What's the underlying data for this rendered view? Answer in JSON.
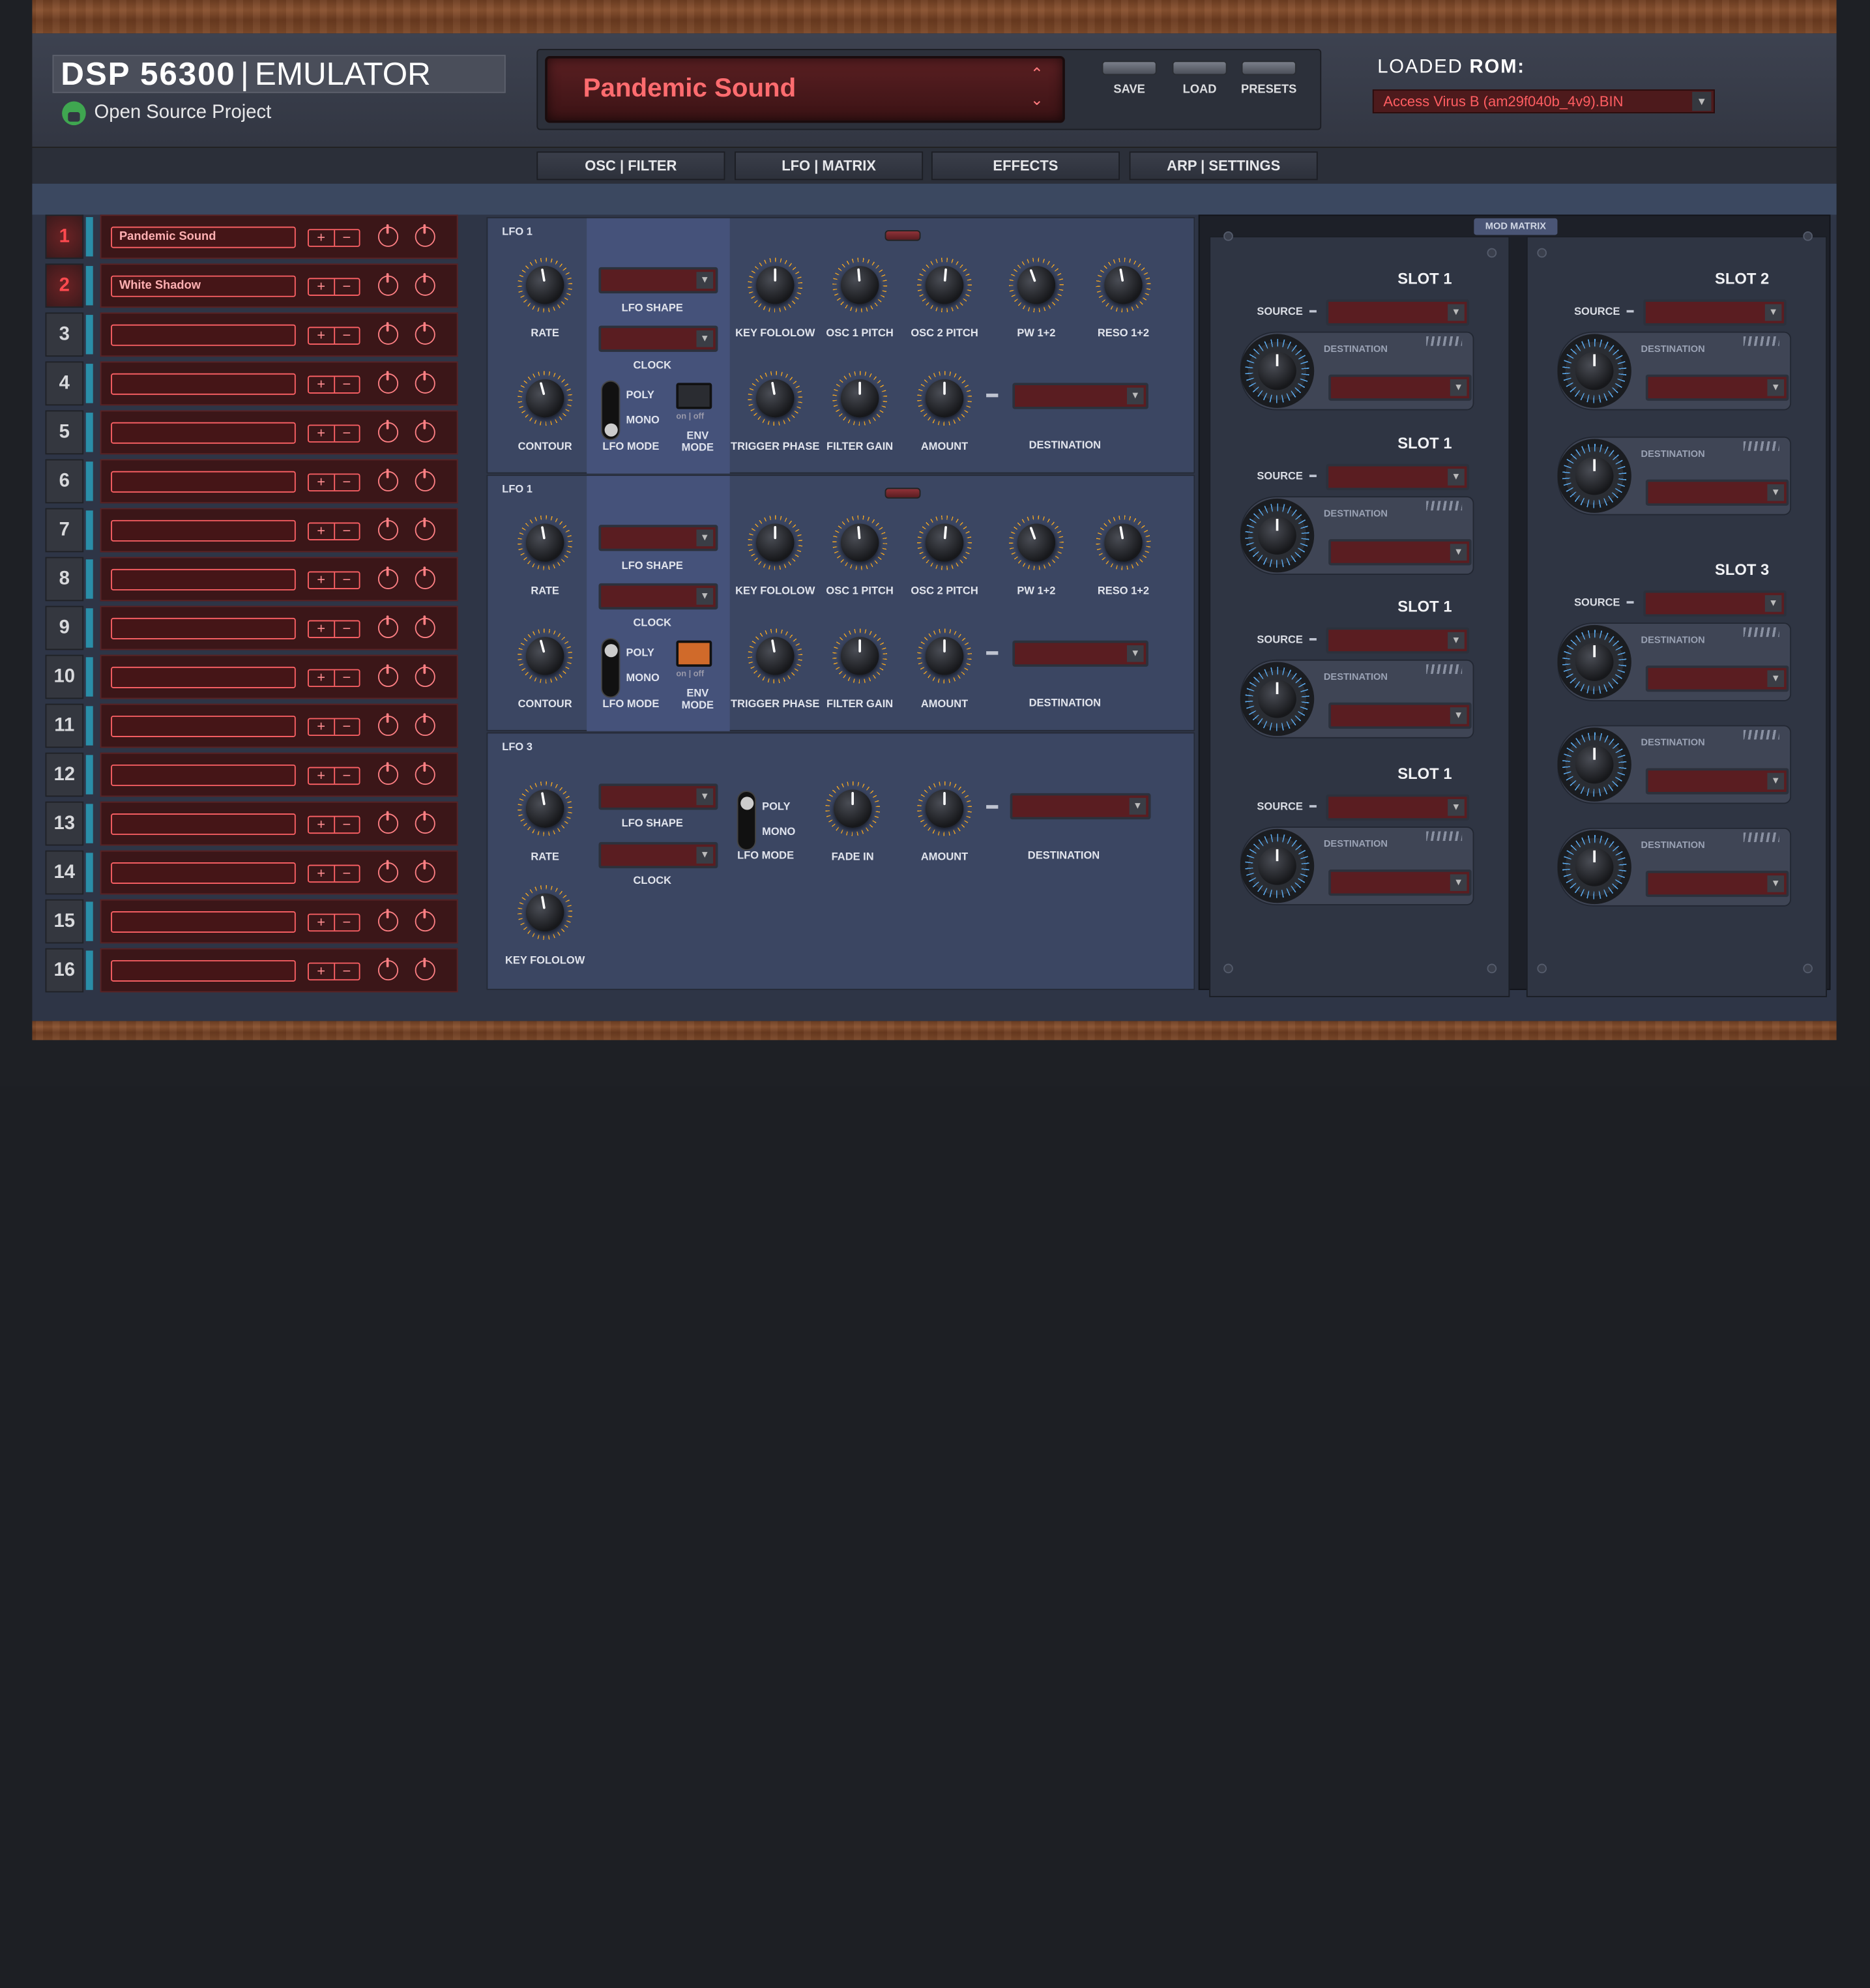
{
  "header": {
    "logo_main": "DSP 56300",
    "logo_sep": "|",
    "logo_sub": "EMULATOR",
    "subtitle": "Open Source Project",
    "patch_name": "Pandemic Sound",
    "buttons": [
      "SAVE",
      "LOAD",
      "PRESETS"
    ],
    "rom_label_a": "LOADED",
    "rom_label_b": "ROM:",
    "rom_value": "Access Virus B (am29f040b_4v9).BIN"
  },
  "tabs": [
    "OSC | FILTER",
    "LFO | MATRIX",
    "EFFECTS",
    "ARP | SETTINGS"
  ],
  "parts": [
    {
      "num": "1",
      "name": "Pandemic Sound"
    },
    {
      "num": "2",
      "name": "White Shadow"
    },
    {
      "num": "3",
      "name": ""
    },
    {
      "num": "4",
      "name": ""
    },
    {
      "num": "5",
      "name": ""
    },
    {
      "num": "6",
      "name": ""
    },
    {
      "num": "7",
      "name": ""
    },
    {
      "num": "8",
      "name": ""
    },
    {
      "num": "9",
      "name": ""
    },
    {
      "num": "10",
      "name": ""
    },
    {
      "num": "11",
      "name": ""
    },
    {
      "num": "12",
      "name": ""
    },
    {
      "num": "13",
      "name": ""
    },
    {
      "num": "14",
      "name": ""
    },
    {
      "num": "15",
      "name": ""
    },
    {
      "num": "16",
      "name": ""
    }
  ],
  "part_controls": {
    "plus": "+",
    "minus": "−"
  },
  "lfo1": {
    "title": "LFO 1",
    "labels": {
      "rate": "RATE",
      "lfo_shape": "LFO SHAPE",
      "clock": "CLOCK",
      "key_follow": "KEY FOLOLOW",
      "osc1_pitch": "OSC 1 PITCH",
      "osc2_pitch": "OSC 2 PITCH",
      "pw": "PW 1+2",
      "reso": "RESO 1+2",
      "contour": "CONTOUR",
      "lfo_mode": "LFO MODE",
      "poly": "POLY",
      "mono": "MONO",
      "env_mode": "ENV MODE",
      "on_off": "on | off",
      "trigger_phase": "TRIGGER PHASE",
      "filter_gain": "FILTER GAIN",
      "amount": "AMOUNT",
      "destination": "DESTINATION"
    }
  },
  "lfo2": {
    "title": "LFO 1",
    "labels": {
      "rate": "RATE",
      "lfo_shape": "LFO SHAPE",
      "clock": "CLOCK",
      "key_follow": "KEY FOLOLOW",
      "osc1_pitch": "OSC 1 PITCH",
      "osc2_pitch": "OSC 2 PITCH",
      "pw": "PW 1+2",
      "reso": "RESO 1+2",
      "contour": "CONTOUR",
      "lfo_mode": "LFO MODE",
      "poly": "POLY",
      "mono": "MONO",
      "env_mode": "ENV MODE",
      "on_off": "on | off",
      "trigger_phase": "TRIGGER PHASE",
      "filter_gain": "FILTER GAIN",
      "amount": "AMOUNT",
      "destination": "DESTINATION"
    }
  },
  "lfo3": {
    "title": "LFO 3",
    "labels": {
      "rate": "RATE",
      "lfo_shape": "LFO SHAPE",
      "clock": "CLOCK",
      "lfo_mode": "LFO MODE",
      "poly": "POLY",
      "mono": "MONO",
      "fade_in": "FADE IN",
      "amount": "AMOUNT",
      "destination": "DESTINATION",
      "key_follow": "KEY FOLOLOW"
    }
  },
  "mod_matrix": {
    "title": "MOD MATRIX",
    "source_label": "SOURCE",
    "destination_label": "DESTINATION",
    "col1_slots": [
      "SLOT 1",
      "SLOT 1",
      "SLOT 1",
      "SLOT 1"
    ],
    "col2_slots": [
      "SLOT 2",
      "SLOT 3"
    ]
  },
  "colors": {
    "accent_red": "#ff6c6f",
    "knob_ring": "#f0a524",
    "matrix_ring": "#5aa6e8",
    "panel": "#3b4662"
  }
}
